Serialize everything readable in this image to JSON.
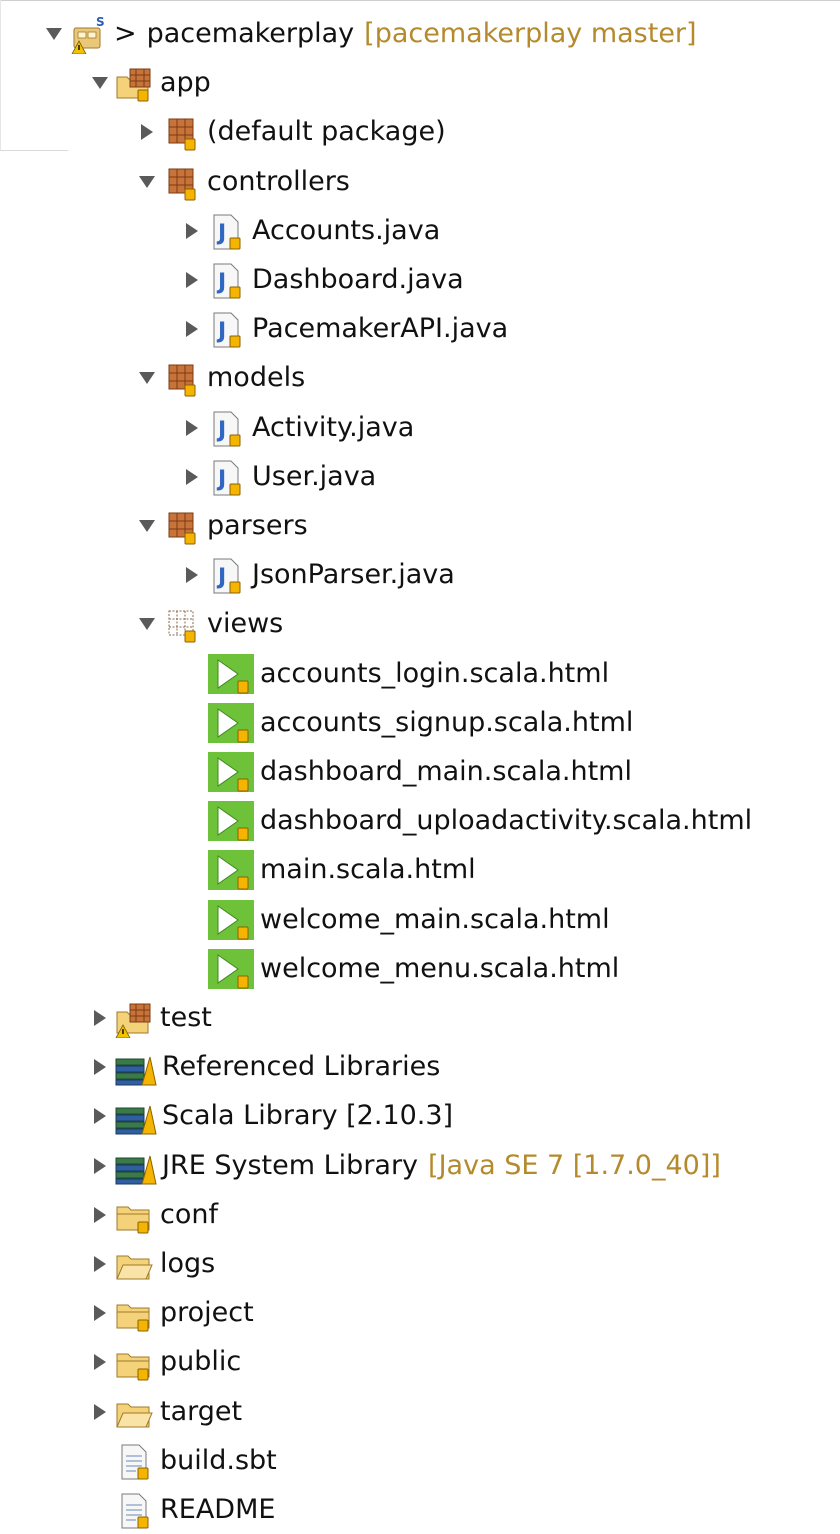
{
  "tree": {
    "project": {
      "prefix": ">",
      "label": "pacemakerplay",
      "decoration": "[pacemakerplay master]"
    },
    "app": {
      "label": "app"
    },
    "default_package": {
      "label": "(default package)"
    },
    "controllers": {
      "label": "controllers",
      "files": [
        "Accounts.java",
        "Dashboard.java",
        "PacemakerAPI.java"
      ]
    },
    "models": {
      "label": "models",
      "files": [
        "Activity.java",
        "User.java"
      ]
    },
    "parsers": {
      "label": "parsers",
      "files": [
        "JsonParser.java"
      ]
    },
    "views": {
      "label": "views",
      "files": [
        "accounts_login.scala.html",
        "accounts_signup.scala.html",
        "dashboard_main.scala.html",
        "dashboard_uploadactivity.scala.html",
        "main.scala.html",
        "welcome_main.scala.html",
        "welcome_menu.scala.html"
      ]
    },
    "test": {
      "label": "test"
    },
    "referenced_libraries": {
      "label": "Referenced Libraries"
    },
    "scala_library": {
      "label": "Scala Library [2.10.3]"
    },
    "jre": {
      "label": "JRE System Library",
      "decoration": "[Java SE 7 [1.7.0_40]]"
    },
    "folders": [
      "conf",
      "logs",
      "project",
      "public",
      "target"
    ],
    "files": [
      "build.sbt",
      "README"
    ]
  },
  "icons": {
    "project": "scala-project-icon",
    "source-folder": "source-folder-icon",
    "package": "package-icon",
    "java-file": "java-file-icon",
    "view-package": "empty-package-icon",
    "template-file": "scala-template-icon",
    "library": "library-icon",
    "folder": "folder-icon",
    "text-file": "text-file-icon"
  },
  "colors": {
    "decoration": "#b58a2c",
    "template_green": "#6ec23a",
    "package_brown": "#a0522d"
  }
}
